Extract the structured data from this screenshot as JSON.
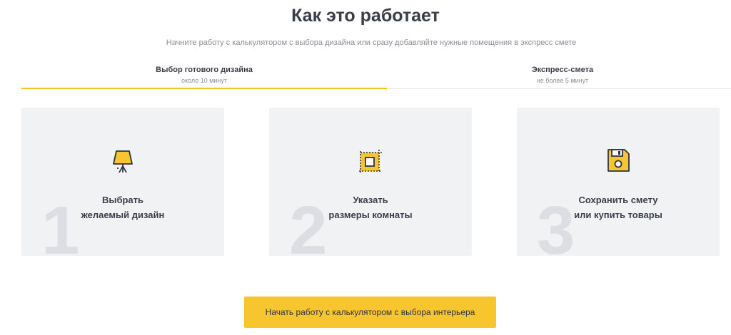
{
  "title": "Как это работает",
  "subtitle": "Начните работу с калькулятором с выбора дизайна или сразу добавляйте нужные помещения в экспресс смете",
  "tabs": [
    {
      "label": "Выбор готового дизайна",
      "sublabel": "около 10 минут",
      "active": true
    },
    {
      "label": "Экспресс-смета",
      "sublabel": "не более 5 минут",
      "active": false
    }
  ],
  "steps": [
    {
      "number": "1",
      "text": "Выбрать\nжелаемый дизайн",
      "icon": "lamp-icon"
    },
    {
      "number": "2",
      "text": "Указать\nразмеры комнаты",
      "icon": "room-size-icon"
    },
    {
      "number": "3",
      "text": "Сохранить смету\nили купить товары",
      "icon": "floppy-disk-icon"
    }
  ],
  "cta_label": "Начать работу с калькулятором с выбора интерьера",
  "colors": {
    "accent": "#f7c62f",
    "card_bg": "#f1f2f4",
    "text": "#3a3e49",
    "muted": "#8a8e97"
  }
}
